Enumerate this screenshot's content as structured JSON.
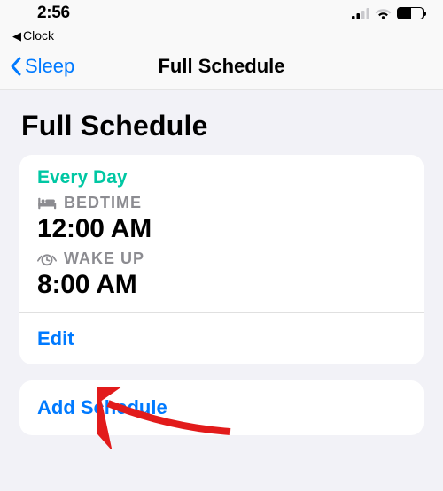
{
  "status": {
    "time": "2:56",
    "back_app": "Clock"
  },
  "nav": {
    "back_label": "Sleep",
    "title": "Full Schedule"
  },
  "page_title": "Full Schedule",
  "schedule": {
    "days_label": "Every Day",
    "bedtime_label": "BEDTIME",
    "bedtime_value": "12:00 AM",
    "wakeup_label": "WAKE UP",
    "wakeup_value": "8:00 AM",
    "edit_label": "Edit"
  },
  "add_schedule_label": "Add Schedule"
}
